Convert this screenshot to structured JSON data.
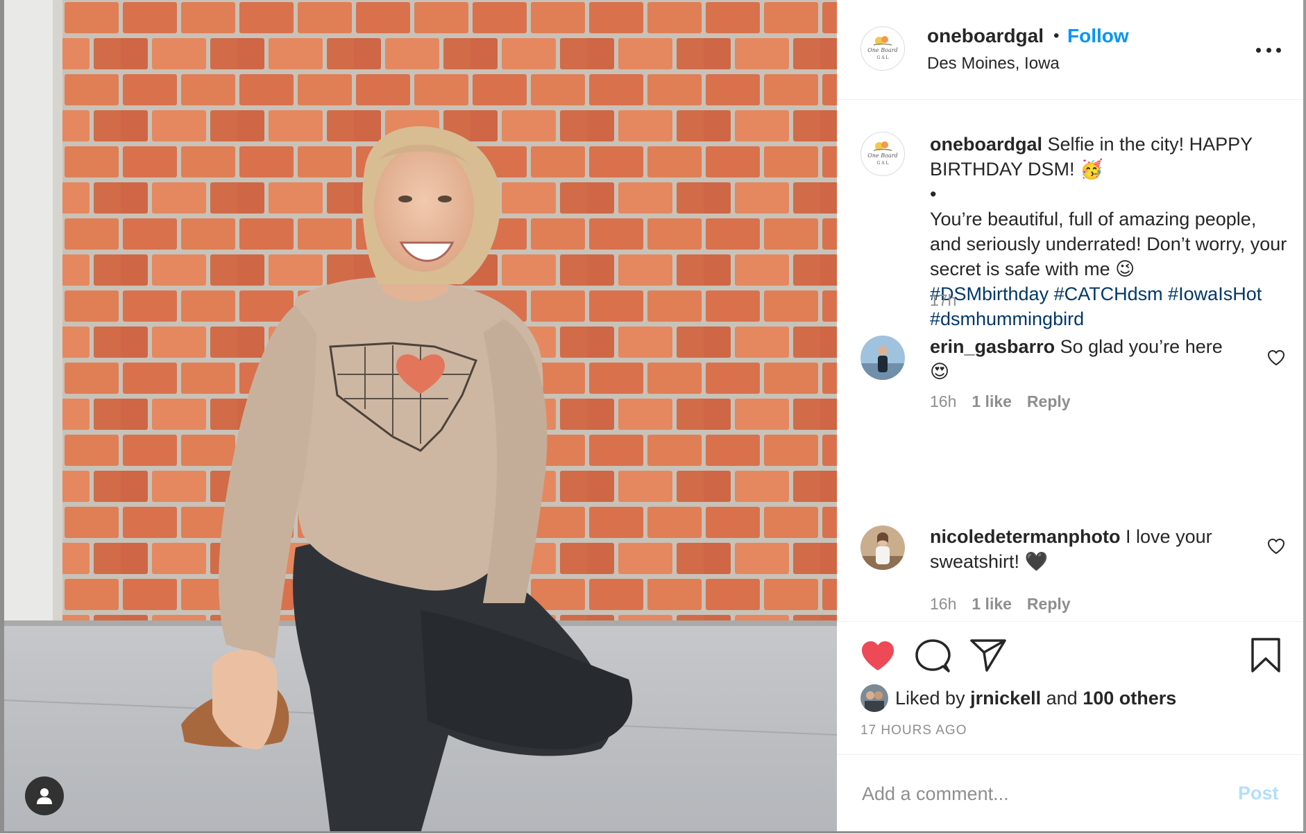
{
  "colors": {
    "accent_blue": "#0095f6",
    "hashtag": "#00376b",
    "like_red": "#ed4956",
    "muted": "#8e8e8e",
    "post_disabled": "#b2dffc"
  },
  "header": {
    "username": "oneboardgal",
    "separator": "•",
    "follow_label": "Follow",
    "location": "Des Moines, Iowa",
    "logo_text": "One Board",
    "logo_sub": "G A L",
    "more_icon": "more-horizontal-icon"
  },
  "caption": {
    "username": "oneboardgal",
    "line1": " Selfie in the city! HAPPY BIRTHDAY DSM! 🥳",
    "bullet": "•",
    "body": "You’re beautiful, full of amazing people, and seriously underrated! Don’t worry, your secret is safe with me 😉",
    "hashtags": [
      "#DSMbirthday",
      "#CATCHdsm",
      "#IowaIsHot",
      "#dsmhummingbird"
    ],
    "time": "17h"
  },
  "comments": [
    {
      "username": "erin_gasbarro",
      "text": " So glad you’re here 😍",
      "time": "16h",
      "likes": "1 like",
      "reply": "Reply"
    },
    {
      "username": "nicoledetermanphoto",
      "text": " I love your sweatshirt! 🖤",
      "time": "16h",
      "likes": "1 like",
      "reply": "Reply"
    }
  ],
  "actions": {
    "like_icon": "heart-filled-icon",
    "comment_icon": "comment-icon",
    "share_icon": "paper-plane-icon",
    "save_icon": "bookmark-icon"
  },
  "likes": {
    "prefix": "Liked by ",
    "user": "jrnickell",
    "middle": " and ",
    "others": "100 others"
  },
  "timestamp": "17 HOURS AGO",
  "add_comment": {
    "placeholder": "Add a comment...",
    "post_label": "Post"
  }
}
